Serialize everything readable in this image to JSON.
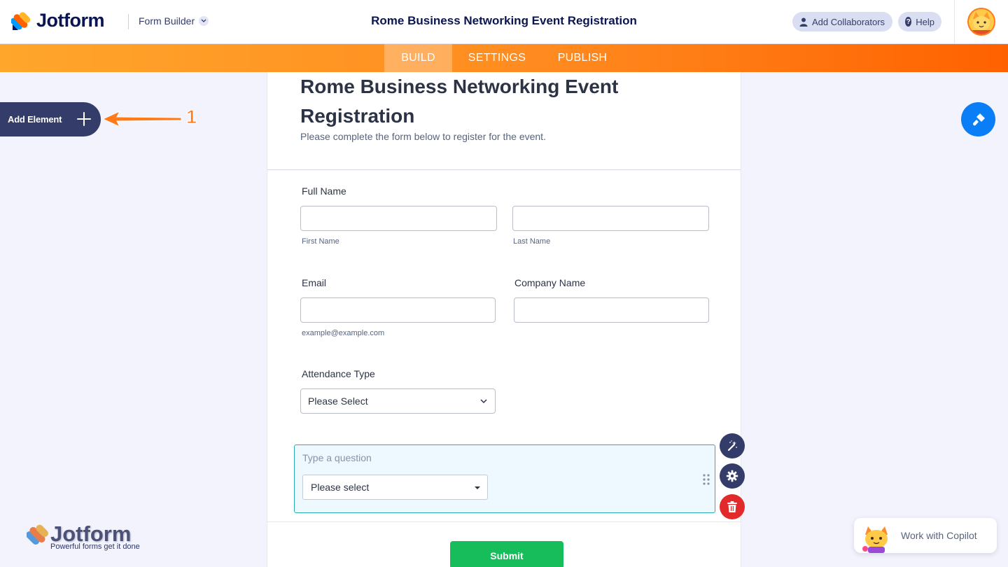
{
  "header": {
    "brand": "Jotform",
    "builder_label": "Form Builder",
    "title": "Rome Business Networking Event Registration",
    "collaborators_label": "Add Collaborators",
    "help_label": "Help"
  },
  "tabs": [
    {
      "label": "BUILD",
      "active": true
    },
    {
      "label": "SETTINGS",
      "active": false
    },
    {
      "label": "PUBLISH",
      "active": false
    }
  ],
  "sidebar": {
    "add_element_label": "Add Element",
    "annotation_number": "1"
  },
  "form": {
    "heading": "Rome Business Networking Event Registration",
    "subheading": "Please complete the form below to register for the event.",
    "full_name": {
      "label": "Full Name",
      "first_sublabel": "First Name",
      "last_sublabel": "Last Name"
    },
    "email": {
      "label": "Email",
      "sublabel": "example@example.com"
    },
    "company": {
      "label": "Company Name"
    },
    "attendance": {
      "label": "Attendance Type",
      "selected": "Please Select"
    },
    "new_question": {
      "placeholder": "Type a question",
      "selected": "Please select"
    },
    "submit_label": "Submit"
  },
  "watermark": {
    "brand": "Jotform",
    "tagline": "Powerful forms get it done"
  },
  "copilot": {
    "label": "Work with Copilot"
  },
  "colors": {
    "navy": "#0a1551",
    "orange": "#ff7a1a",
    "submit_green": "#18bd5b",
    "delete_red": "#e22a2a",
    "paint_blue": "#0a7ef7"
  }
}
